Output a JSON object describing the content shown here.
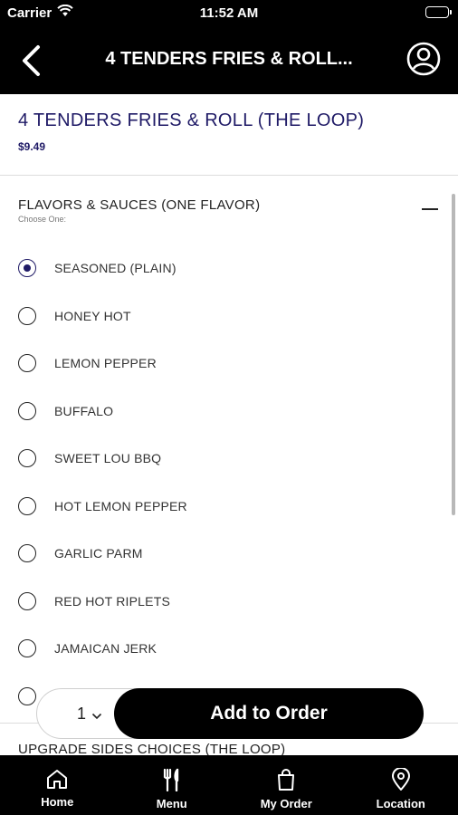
{
  "status": {
    "carrier": "Carrier",
    "time": "11:52 AM"
  },
  "nav": {
    "title": "4 TENDERS FRIES & ROLL..."
  },
  "item": {
    "title": "4 TENDERS FRIES & ROLL (THE LOOP)",
    "price": "$9.49"
  },
  "group": {
    "title": "FLAVORS & SAUCES (ONE FLAVOR)",
    "subtitle": "Choose One:",
    "options": [
      {
        "label": "SEASONED (PLAIN)",
        "selected": true
      },
      {
        "label": "HONEY HOT",
        "selected": false
      },
      {
        "label": "LEMON PEPPER",
        "selected": false
      },
      {
        "label": "BUFFALO",
        "selected": false
      },
      {
        "label": "SWEET LOU BBQ",
        "selected": false
      },
      {
        "label": "HOT LEMON PEPPER",
        "selected": false
      },
      {
        "label": "GARLIC PARM",
        "selected": false
      },
      {
        "label": "RED HOT RIPLETS",
        "selected": false
      },
      {
        "label": "JAMAICAN JERK",
        "selected": false
      }
    ]
  },
  "next_group": {
    "title": "UPGRADE SIDES CHOICES (THE LOOP)"
  },
  "order": {
    "quantity": "1",
    "add_label": "Add to Order"
  },
  "tabs": [
    {
      "label": "Home",
      "icon": "home-icon"
    },
    {
      "label": "Menu",
      "icon": "fork-knife-icon"
    },
    {
      "label": "My Order",
      "icon": "shopping-bag-icon"
    },
    {
      "label": "Location",
      "icon": "location-pin-icon"
    }
  ],
  "colors": {
    "accent": "#1f1a66",
    "bar": "#000000"
  }
}
